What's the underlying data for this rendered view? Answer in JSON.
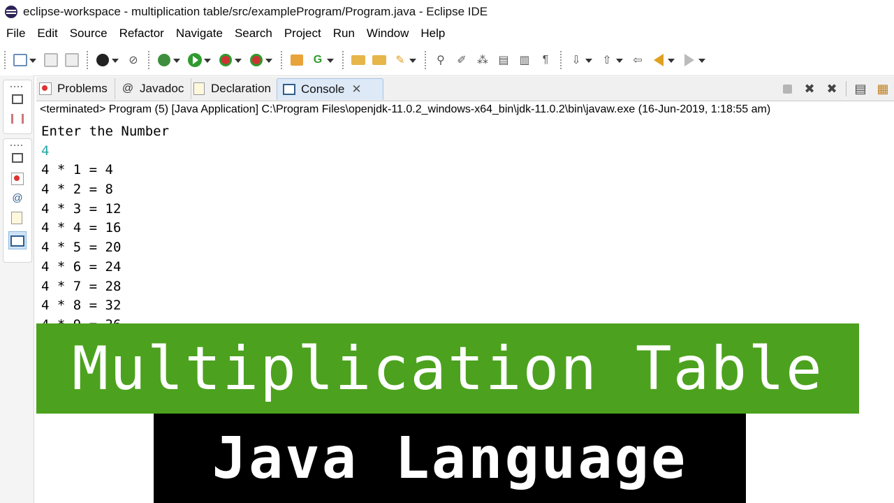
{
  "window": {
    "title": "eclipse-workspace - multiplication table/src/exampleProgram/Program.java - Eclipse IDE"
  },
  "menu": {
    "items": [
      {
        "label": "File"
      },
      {
        "label": "Edit"
      },
      {
        "label": "Source"
      },
      {
        "label": "Refactor"
      },
      {
        "label": "Navigate"
      },
      {
        "label": "Search"
      },
      {
        "label": "Project"
      },
      {
        "label": "Run"
      },
      {
        "label": "Window"
      },
      {
        "label": "Help"
      }
    ]
  },
  "tabs": [
    {
      "label": "Problems",
      "icon": "problems-icon",
      "active": false
    },
    {
      "label": "Javadoc",
      "icon": "javadoc-icon",
      "active": false
    },
    {
      "label": "Declaration",
      "icon": "declaration-icon",
      "active": false
    },
    {
      "label": "Console",
      "icon": "console-icon",
      "active": true,
      "close": "✕"
    }
  ],
  "console": {
    "status": "<terminated> Program (5) [Java Application] C:\\Program Files\\openjdk-11.0.2_windows-x64_bin\\jdk-11.0.2\\bin\\javaw.exe (16-Jun-2019, 1:18:55 am)",
    "lines": [
      {
        "text": "Enter the Number",
        "type": "output"
      },
      {
        "text": "4",
        "type": "input"
      },
      {
        "text": "4 * 1 = 4",
        "type": "output"
      },
      {
        "text": "4 * 2 = 8",
        "type": "output"
      },
      {
        "text": "4 * 3 = 12",
        "type": "output"
      },
      {
        "text": "4 * 4 = 16",
        "type": "output"
      },
      {
        "text": "4 * 5 = 20",
        "type": "output"
      },
      {
        "text": "4 * 6 = 24",
        "type": "output"
      },
      {
        "text": "4 * 7 = 28",
        "type": "output"
      },
      {
        "text": "4 * 8 = 32",
        "type": "output"
      },
      {
        "text": "4 * 9 = 36",
        "type": "output"
      }
    ],
    "input_color": "#22a6a6"
  },
  "banner": {
    "title": "Multiplication Table",
    "subtitle": "Java Language",
    "title_bg": "#4ca21e",
    "subtitle_bg": "#000000"
  }
}
